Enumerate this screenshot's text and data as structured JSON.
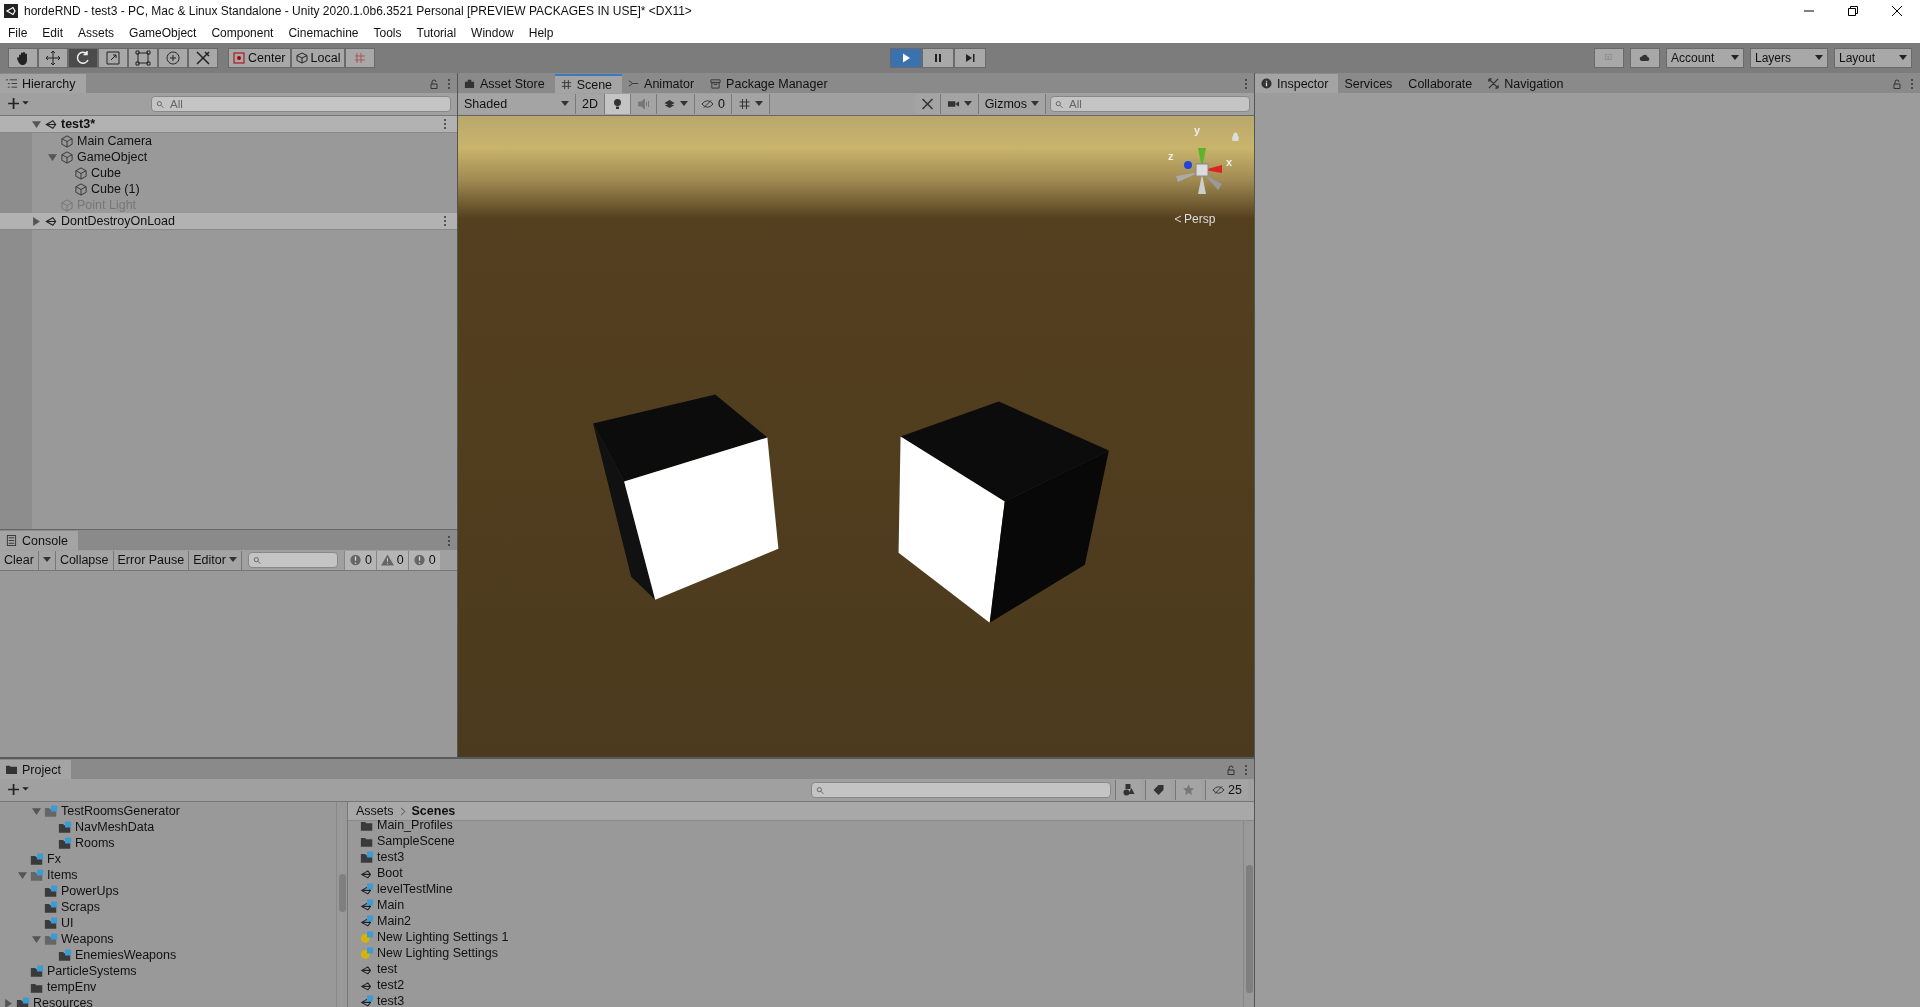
{
  "window": {
    "title": "hordeRND - test3 - PC, Mac & Linux Standalone - Unity 2020.1.0b6.3521 Personal [PREVIEW PACKAGES IN USE]* <DX11>"
  },
  "menu": [
    "File",
    "Edit",
    "Assets",
    "GameObject",
    "Component",
    "Cinemachine",
    "Tools",
    "Tutorial",
    "Window",
    "Help"
  ],
  "toolbar": {
    "tools": [
      {
        "kind": "hand",
        "selected": false
      },
      {
        "kind": "move",
        "selected": false
      },
      {
        "kind": "rotate",
        "selected": true
      },
      {
        "kind": "scale",
        "selected": false
      },
      {
        "kind": "rect",
        "selected": false
      },
      {
        "kind": "transform",
        "selected": false
      },
      {
        "kind": "custom",
        "selected": false
      }
    ],
    "pivot": [
      {
        "label": "Center",
        "kind": "center"
      },
      {
        "label": "Local",
        "kind": "local"
      }
    ],
    "playback": [
      {
        "kind": "play",
        "selected": true
      },
      {
        "kind": "pause",
        "selected": false
      },
      {
        "kind": "step",
        "selected": false
      }
    ],
    "dropdowns": [
      "Account",
      "Layers",
      "Layout"
    ]
  },
  "hierarchy": {
    "tab": "Hierarchy",
    "search": {
      "placeholder": "All"
    },
    "tree": [
      {
        "label": "test3*",
        "kind": "scene",
        "active": true,
        "expanded": true,
        "children": [
          {
            "label": "Main Camera",
            "kind": "object",
            "disabled": false
          },
          {
            "label": "GameObject",
            "kind": "object",
            "disabled": false,
            "expanded": true,
            "children": [
              {
                "label": "Cube",
                "kind": "object",
                "disabled": false
              },
              {
                "label": "Cube (1)",
                "kind": "object",
                "disabled": false
              }
            ]
          },
          {
            "label": "Point Light",
            "kind": "object",
            "disabled": true
          }
        ]
      },
      {
        "label": "DontDestroyOnLoad",
        "kind": "scene",
        "active": false,
        "expanded": false
      }
    ]
  },
  "console": {
    "tab": "Console",
    "buttons": [
      {
        "label": "Clear",
        "dropdown": true
      },
      {
        "label": "Collapse",
        "dropdown": false
      },
      {
        "label": "Error Pause",
        "dropdown": false
      },
      {
        "label": "Editor",
        "dropdown": true
      }
    ],
    "counts": [
      {
        "kind": "log",
        "count": "0"
      },
      {
        "kind": "warning",
        "count": "0"
      },
      {
        "kind": "error",
        "count": "0"
      }
    ]
  },
  "scene_view": {
    "tabs": [
      {
        "label": "Asset Store",
        "kind": "store",
        "selected": false
      },
      {
        "label": "Scene",
        "kind": "scene",
        "selected": true
      },
      {
        "label": "Animator",
        "kind": "animator",
        "selected": false
      },
      {
        "label": "Package Manager",
        "kind": "package",
        "selected": false
      }
    ],
    "shading": "Shaded",
    "mode_2d": "2D",
    "hidden_count": "0",
    "gizmos": "Gizmos",
    "search": {
      "placeholder": "All"
    },
    "axes": [
      "y",
      "z",
      "x"
    ],
    "projection": "Persp"
  },
  "inspector": {
    "tabs": [
      {
        "label": "Inspector",
        "kind": "info",
        "selected": true
      },
      {
        "label": "Services",
        "kind": "plain",
        "selected": false
      },
      {
        "label": "Collaborate",
        "kind": "plain",
        "selected": false
      },
      {
        "label": "Navigation",
        "kind": "navigation",
        "selected": false
      }
    ]
  },
  "project": {
    "tab": "Project",
    "hidden_count": "25",
    "tree": [
      {
        "children": [
          {
            "children": [
              {
                "label": "TestRoomsGenerator",
                "kind": "collab-folder",
                "expanded": true,
                "children": [
                  {
                    "label": "NavMeshData",
                    "kind": "collab-folder"
                  },
                  {
                    "label": "Rooms",
                    "kind": "collab-folder"
                  }
                ]
              }
            ]
          },
          {
            "label": "Fx",
            "kind": "collab-folder"
          },
          {
            "label": "Items",
            "kind": "collab-folder",
            "expanded": true,
            "children": [
              {
                "label": "PowerUps",
                "kind": "collab-folder"
              },
              {
                "label": "Scraps",
                "kind": "collab-folder"
              },
              {
                "label": "UI",
                "kind": "collab-folder"
              },
              {
                "label": "Weapons",
                "kind": "collab-folder",
                "expanded": true,
                "children": [
                  {
                    "label": "EnemiesWeapons",
                    "kind": "collab-folder"
                  }
                ]
              }
            ]
          },
          {
            "label": "ParticleSystems",
            "kind": "collab-folder"
          },
          {
            "label": "tempEnv",
            "kind": "folder"
          }
        ]
      },
      {
        "label": "Resources",
        "kind": "collab-folder",
        "expanded": false
      }
    ],
    "breadcrumb": [
      "Assets",
      "Scenes"
    ],
    "files": [
      {
        "label": "Main_Profiles",
        "kind": "folder"
      },
      {
        "label": "SampleScene",
        "kind": "folder"
      },
      {
        "label": "test3",
        "kind": "collab-folder"
      },
      {
        "label": "Boot",
        "kind": "scene"
      },
      {
        "label": "levelTestMine",
        "kind": "collab-scene"
      },
      {
        "label": "Main",
        "kind": "collab-scene"
      },
      {
        "label": "Main2",
        "kind": "collab-scene"
      },
      {
        "label": "New Lighting Settings 1",
        "kind": "lighting"
      },
      {
        "label": "New Lighting Settings",
        "kind": "lighting"
      },
      {
        "label": "test",
        "kind": "scene"
      },
      {
        "label": "test2",
        "kind": "scene"
      },
      {
        "label": "test3",
        "kind": "collab-scene"
      }
    ]
  }
}
